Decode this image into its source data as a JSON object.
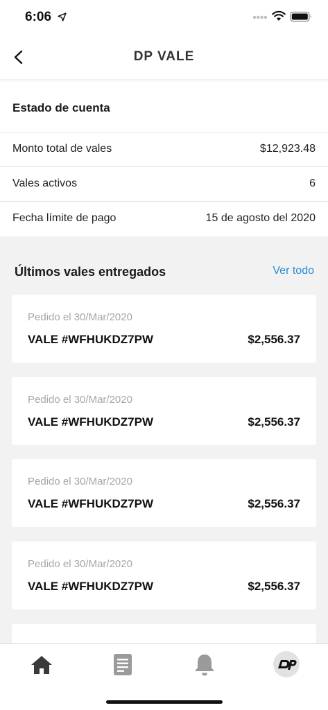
{
  "status_bar": {
    "time": "6:06"
  },
  "header": {
    "title": "DP VALE"
  },
  "account": {
    "title": "Estado de cuenta",
    "rows": [
      {
        "label": "Monto total de vales",
        "value": "$12,923.48"
      },
      {
        "label": "Vales activos",
        "value": "6"
      },
      {
        "label": "Fecha límite de pago",
        "value": "15 de agosto del 2020"
      }
    ]
  },
  "recent": {
    "title": "Últimos vales entregados",
    "see_all": "Ver todo",
    "items": [
      {
        "date": "Pedido el 30/Mar/2020",
        "code": "VALE #WFHUKDZ7PW",
        "amount": "$2,556.37"
      },
      {
        "date": "Pedido el 30/Mar/2020",
        "code": "VALE #WFHUKDZ7PW",
        "amount": "$2,556.37"
      },
      {
        "date": "Pedido el 30/Mar/2020",
        "code": "VALE #WFHUKDZ7PW",
        "amount": "$2,556.37"
      },
      {
        "date": "Pedido el 30/Mar/2020",
        "code": "VALE #WFHUKDZ7PW",
        "amount": "$2,556.37"
      }
    ]
  },
  "tab_bar": {
    "tabs": [
      {
        "icon": "home-icon"
      },
      {
        "icon": "document-icon"
      },
      {
        "icon": "bell-icon"
      },
      {
        "icon": "dp-logo-icon"
      }
    ]
  },
  "colors": {
    "accent": "#2a8ad1",
    "background": "#f2f2f2",
    "muted": "#a6a6a6"
  }
}
